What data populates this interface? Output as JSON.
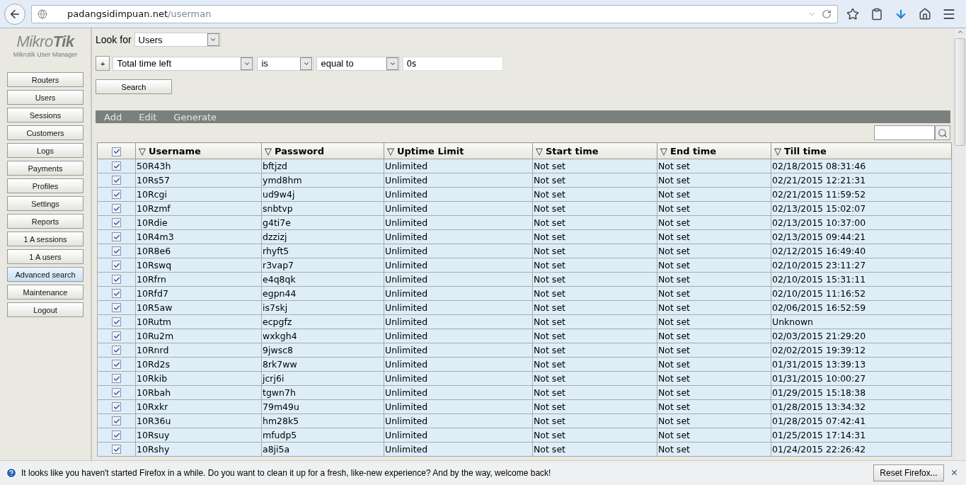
{
  "browser": {
    "url_host": "padangsidimpuan.net",
    "url_path": "/userman"
  },
  "sidebar": {
    "logo_light": "Mikro",
    "logo_bold": "Tik",
    "subtitle": "Mikrotik User Manager",
    "items": [
      {
        "label": "Routers",
        "selected": false
      },
      {
        "label": "Users",
        "selected": false
      },
      {
        "label": "Sessions",
        "selected": false
      },
      {
        "label": "Customers",
        "selected": false
      },
      {
        "label": "Logs",
        "selected": false
      },
      {
        "label": "Payments",
        "selected": false
      },
      {
        "label": "Profiles",
        "selected": false
      },
      {
        "label": "Settings",
        "selected": false
      },
      {
        "label": "Reports",
        "selected": false
      },
      {
        "label": "1 A sessions",
        "selected": false
      },
      {
        "label": "1 A users",
        "selected": false
      },
      {
        "label": "Advanced search",
        "selected": true
      },
      {
        "label": "Maintenance",
        "selected": false
      },
      {
        "label": "Logout",
        "selected": false
      }
    ]
  },
  "search": {
    "look_for_label": "Look for",
    "look_for_value": "Users",
    "add_condition": "+",
    "field": "Total time left",
    "operator": "is",
    "comparison": "equal to",
    "value": "0s",
    "button": "Search"
  },
  "actions": [
    "Add",
    "Edit",
    "Generate"
  ],
  "table": {
    "select_all_checked": true,
    "sort_mark": "▽",
    "columns": [
      "Username",
      "Password",
      "Uptime Limit",
      "Start time",
      "End time",
      "Till time"
    ],
    "rows": [
      {
        "checked": true,
        "cells": [
          "50R43h",
          "bftjzd",
          "Unlimited",
          "Not set",
          "Not set",
          "02/18/2015 08:31:46"
        ]
      },
      {
        "checked": true,
        "cells": [
          "10Rs57",
          "ymd8hm",
          "Unlimited",
          "Not set",
          "Not set",
          "02/21/2015 12:21:31"
        ]
      },
      {
        "checked": true,
        "cells": [
          "10Rcgi",
          "ud9w4j",
          "Unlimited",
          "Not set",
          "Not set",
          "02/21/2015 11:59:52"
        ]
      },
      {
        "checked": true,
        "cells": [
          "10Rzmf",
          "snbtvp",
          "Unlimited",
          "Not set",
          "Not set",
          "02/13/2015 15:02:07"
        ]
      },
      {
        "checked": true,
        "cells": [
          "10Rdie",
          "g4ti7e",
          "Unlimited",
          "Not set",
          "Not set",
          "02/13/2015 10:37:00"
        ]
      },
      {
        "checked": true,
        "cells": [
          "10R4m3",
          "dzzizj",
          "Unlimited",
          "Not set",
          "Not set",
          "02/13/2015 09:44:21"
        ]
      },
      {
        "checked": true,
        "cells": [
          "10R8e6",
          "rhyft5",
          "Unlimited",
          "Not set",
          "Not set",
          "02/12/2015 16:49:40"
        ]
      },
      {
        "checked": true,
        "cells": [
          "10Rswq",
          "r3vap7",
          "Unlimited",
          "Not set",
          "Not set",
          "02/10/2015 23:11:27"
        ]
      },
      {
        "checked": true,
        "cells": [
          "10Rfrn",
          "e4q8qk",
          "Unlimited",
          "Not set",
          "Not set",
          "02/10/2015 15:31:11"
        ]
      },
      {
        "checked": true,
        "cells": [
          "10Rfd7",
          "egpn44",
          "Unlimited",
          "Not set",
          "Not set",
          "02/10/2015 11:16:52"
        ]
      },
      {
        "checked": true,
        "cells": [
          "10R5aw",
          "is7skj",
          "Unlimited",
          "Not set",
          "Not set",
          "02/06/2015 16:52:59"
        ]
      },
      {
        "checked": true,
        "cells": [
          "10Rutm",
          "ecpgfz",
          "Unlimited",
          "Not set",
          "Not set",
          "Unknown"
        ]
      },
      {
        "checked": true,
        "cells": [
          "10Ru2m",
          "wxkgh4",
          "Unlimited",
          "Not set",
          "Not set",
          "02/03/2015 21:29:20"
        ]
      },
      {
        "checked": true,
        "cells": [
          "10Rnrd",
          "9jwsc8",
          "Unlimited",
          "Not set",
          "Not set",
          "02/02/2015 19:39:12"
        ]
      },
      {
        "checked": true,
        "cells": [
          "10Rd2s",
          "8rk7ww",
          "Unlimited",
          "Not set",
          "Not set",
          "01/31/2015 13:39:13"
        ]
      },
      {
        "checked": true,
        "cells": [
          "10Rkib",
          "jcrj6i",
          "Unlimited",
          "Not set",
          "Not set",
          "01/31/2015 10:00:27"
        ]
      },
      {
        "checked": true,
        "cells": [
          "10Rbah",
          "tgwn7h",
          "Unlimited",
          "Not set",
          "Not set",
          "01/29/2015 15:18:38"
        ]
      },
      {
        "checked": true,
        "cells": [
          "10Rxkr",
          "79m49u",
          "Unlimited",
          "Not set",
          "Not set",
          "01/28/2015 13:34:32"
        ]
      },
      {
        "checked": true,
        "cells": [
          "10R36u",
          "hm28k5",
          "Unlimited",
          "Not set",
          "Not set",
          "01/28/2015 07:42:41"
        ]
      },
      {
        "checked": true,
        "cells": [
          "10Rsuy",
          "mfudp5",
          "Unlimited",
          "Not set",
          "Not set",
          "01/25/2015 17:14:31"
        ]
      },
      {
        "checked": true,
        "cells": [
          "10Rshy",
          "a8ji5a",
          "Unlimited",
          "Not set",
          "Not set",
          "01/24/2015 22:26:42"
        ]
      }
    ]
  },
  "notification": {
    "message": "It looks like you haven't started Firefox in a while. Do you want to clean it up for a fresh, like-new experience? And by the way, welcome back!",
    "button": "Reset Firefox...",
    "close": "×"
  }
}
